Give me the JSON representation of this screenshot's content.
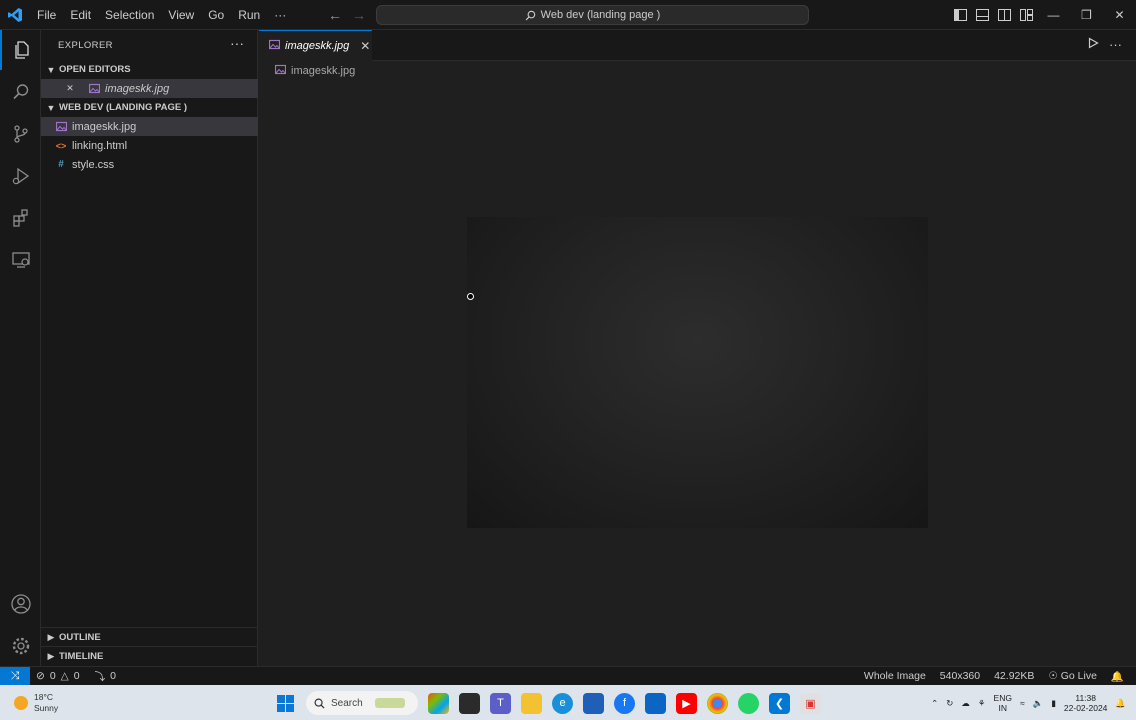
{
  "titlebar": {
    "menus": [
      "File",
      "Edit",
      "Selection",
      "View",
      "Go",
      "Run",
      "···"
    ],
    "command_center": "Web dev (landing page )",
    "window_controls": {
      "minimize": "—",
      "restore": "❒",
      "close": "✕"
    }
  },
  "sidebar": {
    "title": "EXPLORER",
    "more": "···",
    "open_editors": {
      "header": "OPEN EDITORS",
      "items": [
        {
          "label": "imageskk.jpg",
          "close": "✕"
        }
      ]
    },
    "workspace": {
      "header": "WEB DEV (LANDING PAGE )",
      "files": [
        {
          "label": "imageskk.jpg",
          "icon": "image-file-icon",
          "selected": true
        },
        {
          "label": "linking.html",
          "icon": "html-file-icon",
          "selected": false
        },
        {
          "label": "style.css",
          "icon": "css-file-icon",
          "selected": false
        }
      ]
    },
    "outline": "OUTLINE",
    "timeline": "TIMELINE"
  },
  "editor": {
    "tab_label": "imageskk.jpg",
    "tab_close": "✕",
    "breadcrumb": "imageskk.jpg"
  },
  "statusbar": {
    "errors": "0",
    "warnings": "0",
    "ports": "0",
    "zoom_mode": "Whole Image",
    "dimensions": "540x360",
    "file_size": "42.92KB",
    "golive": "Go Live"
  },
  "taskbar": {
    "weather_temp": "18°C",
    "weather_desc": "Sunny",
    "search_placeholder": "Search",
    "lang_top": "ENG",
    "lang_bottom": "IN",
    "time": "11:38",
    "date": "22-02-2024"
  },
  "colors": {
    "accent": "#0078d4",
    "editor_bg": "#1f1f1f",
    "chrome_bg": "#181818",
    "selection": "#37373d"
  }
}
